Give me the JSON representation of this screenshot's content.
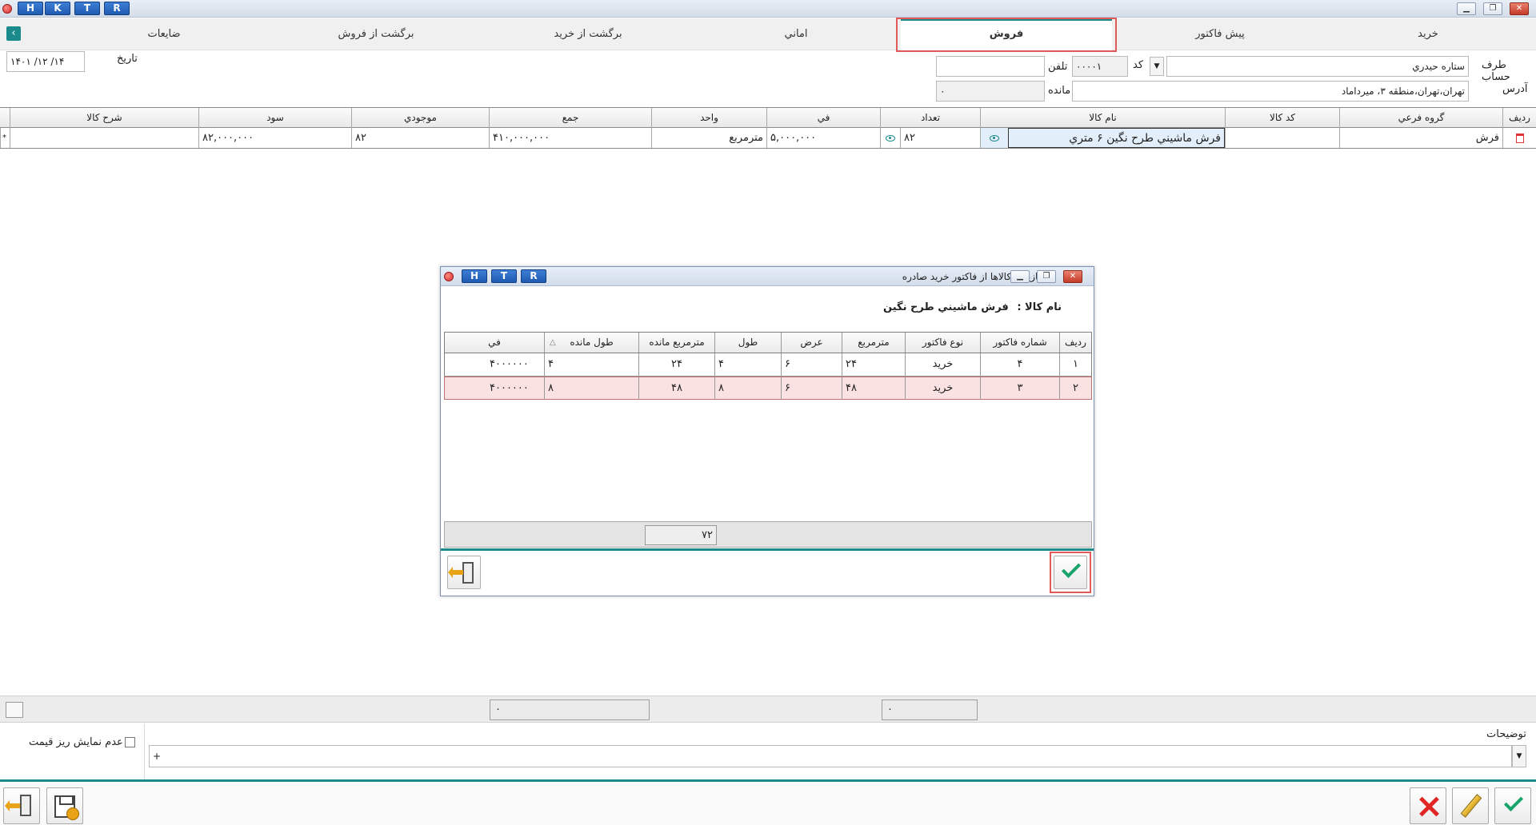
{
  "titlebar": {
    "buttons": [
      "H",
      "K",
      "T",
      "R"
    ]
  },
  "tabs": [
    {
      "label": "خريد",
      "active": false
    },
    {
      "label": "پيش فاکتور",
      "active": false
    },
    {
      "label": "فروش",
      "active": true
    },
    {
      "label": "اماني",
      "active": false
    },
    {
      "label": "برگشت از خريد",
      "active": false
    },
    {
      "label": "برگشت از فروش",
      "active": false
    },
    {
      "label": "ضايعات",
      "active": false
    }
  ],
  "form": {
    "account_label": "طرف حساب",
    "account_value": "ستاره حيدري",
    "code_label": "کد",
    "code_value": "۰۰۰۰۱",
    "phone_label": "تلفن",
    "phone_value": "",
    "address_label": "آدرس",
    "address_value": "تهران،تهران،منطقه ۳، ميرداماد",
    "remain_label": "مانده",
    "remain_value": "۰",
    "date_label": "تاريخ",
    "date_value": "۱۴۰۱ /۱۲ /۱۴"
  },
  "grid": {
    "headers": [
      "رديف",
      "گروه فرعي",
      "کد کالا",
      "نام کالا",
      "تعداد",
      "في",
      "واحد",
      "جمع",
      "موجودي",
      "سود",
      "شرح کالا"
    ],
    "rows": [
      {
        "group": "فرش",
        "code": "",
        "name": "فرش ماشيني طرح نگين ۶ متري",
        "qty": "۸۲",
        "price": "۵,۰۰۰,۰۰۰",
        "unit": "مترمربع",
        "total": "۴۱۰,۰۰۰,۰۰۰",
        "stock": "۸۲",
        "profit": "۸۲,۰۰۰,۰۰۰",
        "desc": ""
      }
    ],
    "row_marker": "*"
  },
  "dialog": {
    "title": "بازيابي کالاها از فاکتور خريد صادره",
    "buttons": [
      "H",
      "T",
      "R"
    ],
    "product_label": "نام کالا :",
    "product_value": "فرش ماشيني طرح نگين",
    "headers": [
      "رديف",
      "شماره فاکتور",
      "نوع فاکتور",
      "مترمربع",
      "عرض",
      "طول",
      "مترمربع مانده",
      "طول مانده",
      "في"
    ],
    "sort_indicator": "△",
    "rows": [
      {
        "idx": "۱",
        "invoice": "۴",
        "type": "خريد",
        "area": "۲۴",
        "width": "۶",
        "length": "۴",
        "area_remain": "۲۴",
        "len_remain": "۴",
        "price": "۴۰۰۰۰۰۰"
      },
      {
        "idx": "۲",
        "invoice": "۳",
        "type": "خريد",
        "area": "۴۸",
        "width": "۶",
        "length": "۸",
        "area_remain": "۴۸",
        "len_remain": "۸",
        "price": "۴۰۰۰۰۰۰"
      }
    ],
    "sum_value": "۷۲"
  },
  "summary": {
    "left_value": "۰",
    "right_value": "۰"
  },
  "notes": {
    "label": "توضيحات",
    "value": "+",
    "hide_price_label": "عدم نمايش ريز قيمت"
  },
  "colors": {
    "accent": "#1a8a8a",
    "highlight": "#e05a5a",
    "selected_row": "#fbe2e2"
  }
}
